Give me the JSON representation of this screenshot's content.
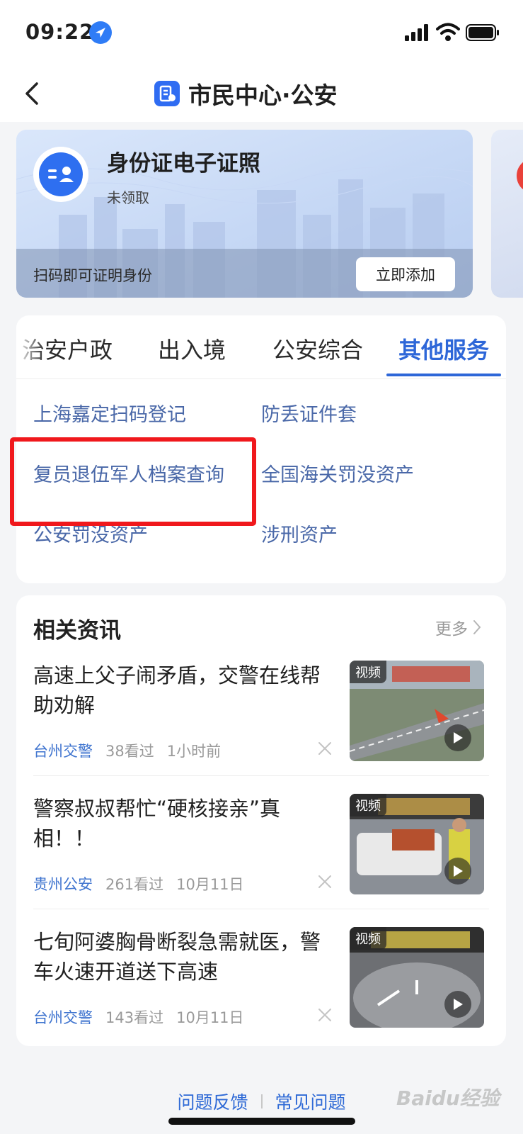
{
  "status_bar": {
    "time": "09:22"
  },
  "nav": {
    "title": "市民中心·公安"
  },
  "id_card": {
    "title": "身份证电子证照",
    "subtitle": "未领取",
    "footer_text": "扫码即可证明身份",
    "add_button": "立即添加"
  },
  "services": {
    "tabs": [
      {
        "label": "治安户政",
        "active": false
      },
      {
        "label": "出入境",
        "active": false
      },
      {
        "label": "公安综合",
        "active": false
      },
      {
        "label": "其他服务",
        "active": true
      }
    ],
    "items": [
      {
        "label": "上海嘉定扫码登记"
      },
      {
        "label": "防丢证件套"
      },
      {
        "label": "复员退伍军人档案查询"
      },
      {
        "label": "全国海关罚没资产"
      },
      {
        "label": "公安罚没资产"
      },
      {
        "label": "涉刑资产"
      }
    ]
  },
  "news": {
    "title": "相关资讯",
    "more": "更多",
    "items": [
      {
        "title": "高速上父子闹矛盾，交警在线帮助劝解",
        "source": "台州交警",
        "views": "38看过",
        "time": "1小时前",
        "tag": "视频"
      },
      {
        "title": "警察叔叔帮忙“硬核接亲”真相！！",
        "source": "贵州公安",
        "views": "261看过",
        "time": "10月11日",
        "tag": "视频"
      },
      {
        "title": "七旬阿婆胸骨断裂急需就医，警车火速开道送下高速",
        "source": "台州交警",
        "views": "143看过",
        "time": "10月11日",
        "tag": "视频"
      }
    ]
  },
  "footer": {
    "feedback": "问题反馈",
    "faq": "常见问题"
  },
  "watermark": "Baidu经验",
  "colors": {
    "accent": "#2e67d8",
    "link": "#4a68a8",
    "highlight": "#f0181c"
  }
}
